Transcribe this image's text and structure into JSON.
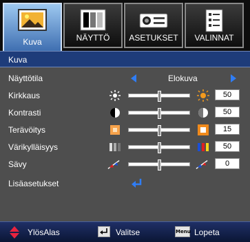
{
  "tabs": [
    {
      "label": "Kuva",
      "icon": "picture-icon",
      "active": true
    },
    {
      "label": "NÄYTTÖ",
      "icon": "display-icon",
      "active": false
    },
    {
      "label": "ASETUKSET",
      "icon": "projector-icon",
      "active": false
    },
    {
      "label": "VALINNAT",
      "icon": "checklist-icon",
      "active": false
    }
  ],
  "section_title": "Kuva",
  "display_mode": {
    "label": "Näyttötila",
    "value": "Elokuva"
  },
  "sliders": [
    {
      "label": "Kirkkaus",
      "value": "50",
      "level": 0.5,
      "icon_left": "sun-dim-icon",
      "icon_right": "sun-bright-icon"
    },
    {
      "label": "Kontrasti",
      "value": "50",
      "level": 0.5,
      "icon_left": "contrast-icon",
      "icon_right": "contrast-high-icon"
    },
    {
      "label": "Terävöitys",
      "value": "15",
      "level": 0.5,
      "icon_left": "sharpness-low-icon",
      "icon_right": "sharpness-high-icon"
    },
    {
      "label": "Värikylläisyys",
      "value": "50",
      "level": 0.5,
      "icon_left": "saturation-low-icon",
      "icon_right": "saturation-high-icon"
    },
    {
      "label": "Sävy",
      "value": "0",
      "level": 0.5,
      "icon_left": "tint-low-icon",
      "icon_right": "tint-high-icon"
    }
  ],
  "advanced": {
    "label": "Lisäasetukset",
    "icon": "enter-icon"
  },
  "footer": {
    "updown_label": "YlösAlas",
    "select_label": "Valitse",
    "exit_label": "Lopeta",
    "menu_key": "Menu"
  },
  "colors": {
    "accent_blue": "#2f7df5",
    "section_bar": "#1e3c7a",
    "background": "#4e4e4e"
  }
}
